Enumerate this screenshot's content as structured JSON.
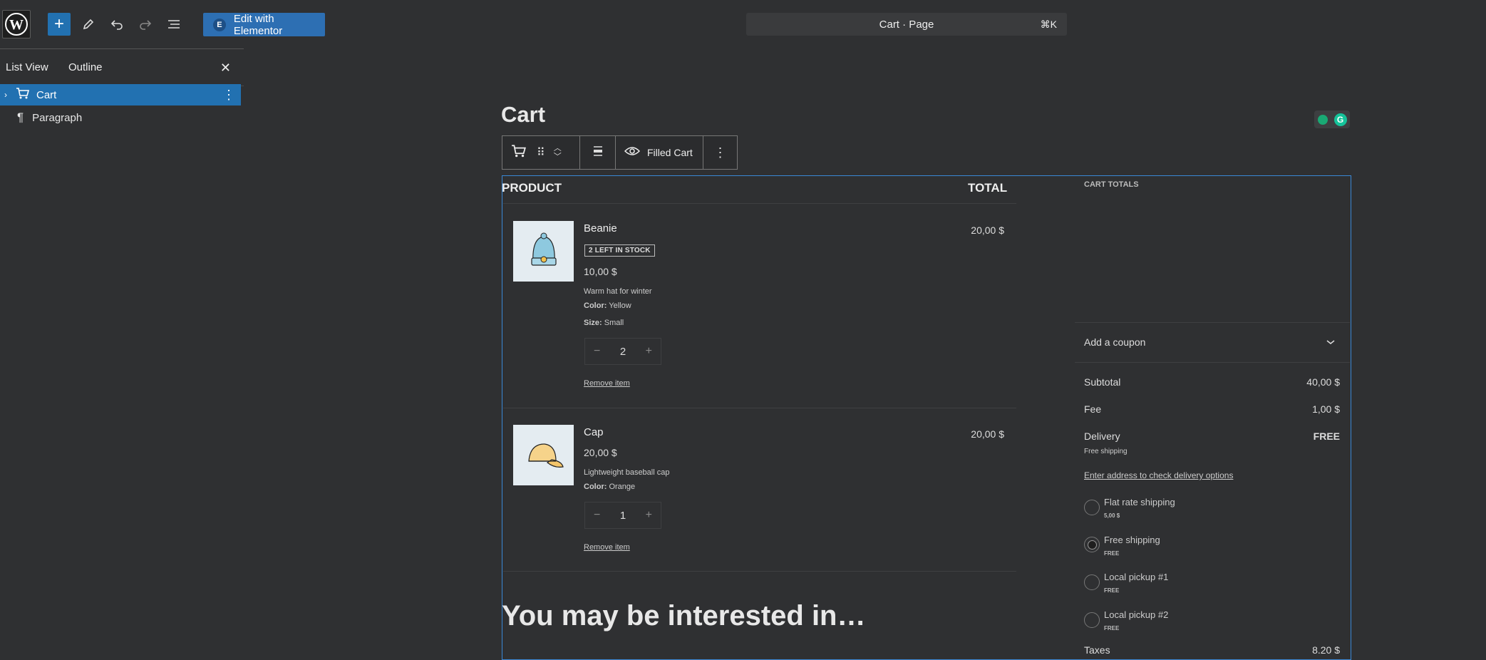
{
  "topbar": {
    "elementor_label": "Edit with Elementor",
    "command_title": "Cart · Page",
    "command_shortcut": "⌘K"
  },
  "sidebar": {
    "tabs": [
      {
        "label": "List View"
      },
      {
        "label": "Outline"
      }
    ],
    "items": [
      {
        "label": "Cart"
      },
      {
        "label": "Paragraph"
      }
    ]
  },
  "page": {
    "title": "Cart",
    "toolbar_view_label": "Filled Cart"
  },
  "cart": {
    "headers": {
      "product": "PRODUCT",
      "total": "TOTAL"
    },
    "items": [
      {
        "name": "Beanie",
        "badge": "2 LEFT IN STOCK",
        "price": "10,00 $",
        "description": "Warm hat for winter",
        "attr1_key": "Color:",
        "attr1_val": "Yellow",
        "attr2_key": "Size:",
        "attr2_val": "Small",
        "qty": "2",
        "remove": "Remove item",
        "line_total": "20,00 $"
      },
      {
        "name": "Cap",
        "price": "20,00 $",
        "description": "Lightweight baseball cap",
        "attr1_key": "Color:",
        "attr1_val": "Orange",
        "qty": "1",
        "remove": "Remove item",
        "line_total": "20,00 $"
      }
    ],
    "cross_sell_title": "You may be interested in…"
  },
  "totals": {
    "title": "CART TOTALS",
    "coupon": "Add a coupon",
    "subtotal_label": "Subtotal",
    "subtotal_value": "40,00 $",
    "fee_label": "Fee",
    "fee_value": "1,00 $",
    "delivery_label": "Delivery",
    "delivery_value": "FREE",
    "delivery_sub": "Free shipping",
    "address_link": "Enter address to check delivery options",
    "options": [
      {
        "name": "Flat rate shipping",
        "sub": "5,00 $",
        "selected": false
      },
      {
        "name": "Free shipping",
        "sub": "FREE",
        "selected": true
      },
      {
        "name": "Local pickup #1",
        "sub": "FREE",
        "selected": false
      },
      {
        "name": "Local pickup #2",
        "sub": "FREE",
        "selected": false
      }
    ],
    "taxes_label": "Taxes",
    "taxes_value": "8,20 $"
  },
  "colors": {
    "accent": "#2271b1",
    "selection_border": "#3a88d6",
    "background": "#2f3032"
  }
}
